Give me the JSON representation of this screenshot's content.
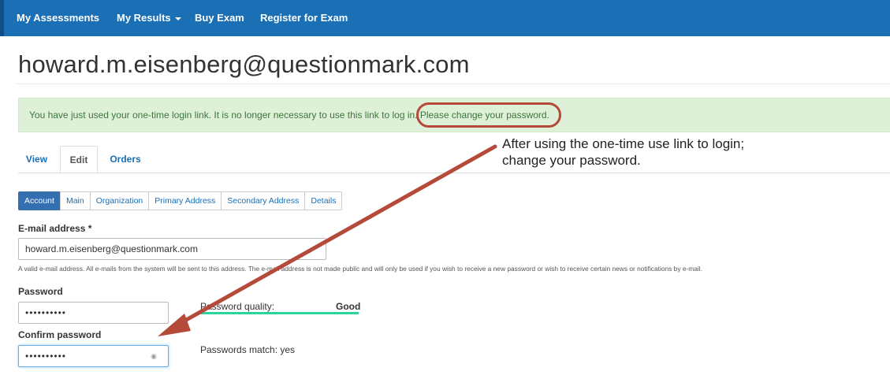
{
  "nav": {
    "items": [
      {
        "label": "My Assessments"
      },
      {
        "label": "My Results"
      },
      {
        "label": "Buy Exam"
      },
      {
        "label": "Register for Exam"
      }
    ]
  },
  "page": {
    "title": "howard.m.eisenberg@questionmark.com"
  },
  "alert": {
    "message": "You have just used your one-time login link. It is no longer necessary to use this link to log in. Please change your password."
  },
  "tabs": [
    {
      "label": "View"
    },
    {
      "label": "Edit"
    },
    {
      "label": "Orders"
    }
  ],
  "active_tab": "Edit",
  "annotation": {
    "line1": "After using the one-time use link to login;",
    "line2": "change your password."
  },
  "subtabs": [
    {
      "label": "Account"
    },
    {
      "label": "Main"
    },
    {
      "label": "Organization"
    },
    {
      "label": "Primary Address"
    },
    {
      "label": "Secondary Address"
    },
    {
      "label": "Details"
    }
  ],
  "active_subtab": "Account",
  "form": {
    "email_label": "E-mail address *",
    "email_value": "howard.m.eisenberg@questionmark.com",
    "email_help": "A valid e-mail address. All e-mails from the system will be sent to this address. The e-mail address is not made public and will only be used if you wish to receive a new password or wish to receive certain news or notifications by e-mail.",
    "password_label": "Password",
    "password_value": "••••••••••",
    "confirm_label": "Confirm password",
    "confirm_value": "••••••••••",
    "quality_label": "Password quality:",
    "quality_value": "Good",
    "match_text": "Passwords match: yes"
  },
  "colors": {
    "navbar": "#1a6fb5",
    "alert_bg": "#dff0d8",
    "alert_text": "#3c763d",
    "annotation_arrow": "#b54a3a",
    "quality_bar": "#2bd59a"
  }
}
